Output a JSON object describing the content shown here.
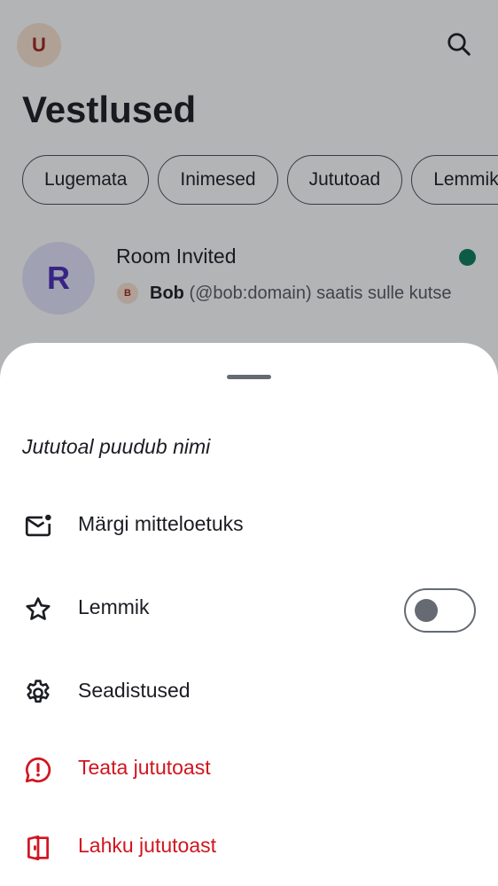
{
  "header": {
    "user_avatar_letter": "U",
    "title": "Vestlused"
  },
  "filters": [
    {
      "label": "Lugemata"
    },
    {
      "label": "Inimesed"
    },
    {
      "label": "Jututoad"
    },
    {
      "label": "Lemmikud"
    }
  ],
  "room": {
    "avatar_letter": "R",
    "name": "Room Invited",
    "inviter_avatar_letter": "B",
    "inviter_name": "Bob",
    "invite_text": "(@bob:domain) saatis sulle kutse",
    "unread": true
  },
  "sheet": {
    "title": "Jututoal puudub nimi",
    "items": [
      {
        "label": "Märgi mitteloetuks",
        "icon": "mail-unread-icon"
      },
      {
        "label": "Lemmik",
        "icon": "star-icon",
        "toggle_on": false
      },
      {
        "label": "Seadistused",
        "icon": "settings-gear-icon"
      },
      {
        "label": "Teata jututoast",
        "icon": "report-chat-icon",
        "danger": true
      },
      {
        "label": "Lahku jututoast",
        "icon": "leave-door-icon",
        "danger": true
      }
    ]
  },
  "colors": {
    "accent_green": "#0b7d5a",
    "danger_red": "#d1151f",
    "avatar_room_bg": "#e4e3fb",
    "avatar_room_fg": "#4b2bb5",
    "avatar_user_bg": "#fbe4d2",
    "avatar_user_fg": "#a3261d"
  }
}
